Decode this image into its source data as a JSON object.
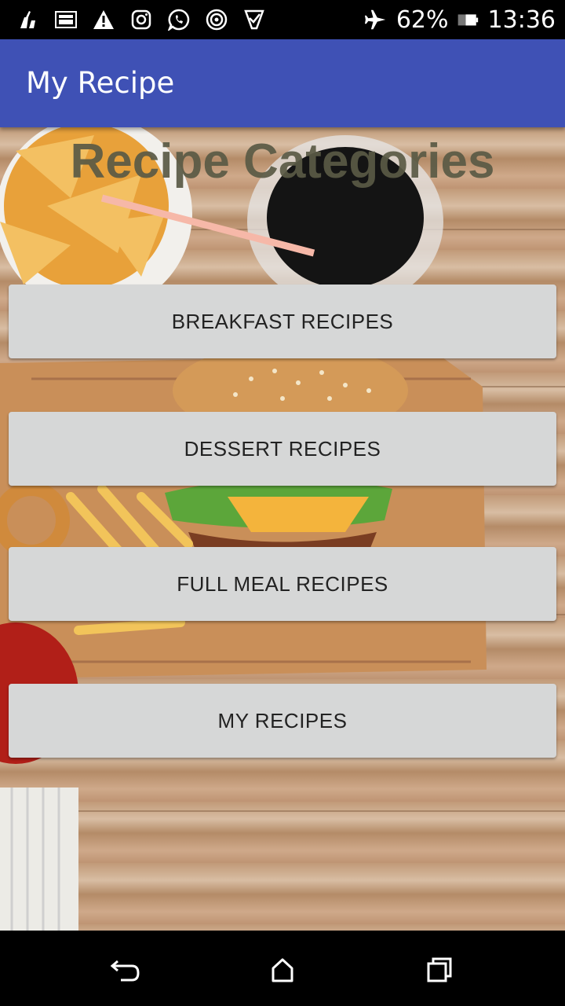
{
  "status_bar": {
    "battery": "62%",
    "time": "13:36",
    "icons": [
      "clean-icon",
      "screenshot-icon",
      "warning-icon",
      "instagram-icon",
      "whatsapp-icon",
      "sync-icon",
      "check-icon",
      "airplane-icon",
      "battery-icon"
    ]
  },
  "app_bar": {
    "title": "My Recipe"
  },
  "main": {
    "heading": "Recipe Categories",
    "background": "food-photo",
    "buttons": [
      {
        "label": "BREAKFAST RECIPES"
      },
      {
        "label": "DESSERT RECIPES"
      },
      {
        "label": "FULL MEAL RECIPES"
      },
      {
        "label": "MY RECIPES"
      }
    ]
  },
  "nav_bar": {
    "icons": [
      "back-icon",
      "home-icon",
      "recents-icon"
    ]
  },
  "colors": {
    "primary": "#3F51B5",
    "button": "#D6D7D7"
  }
}
